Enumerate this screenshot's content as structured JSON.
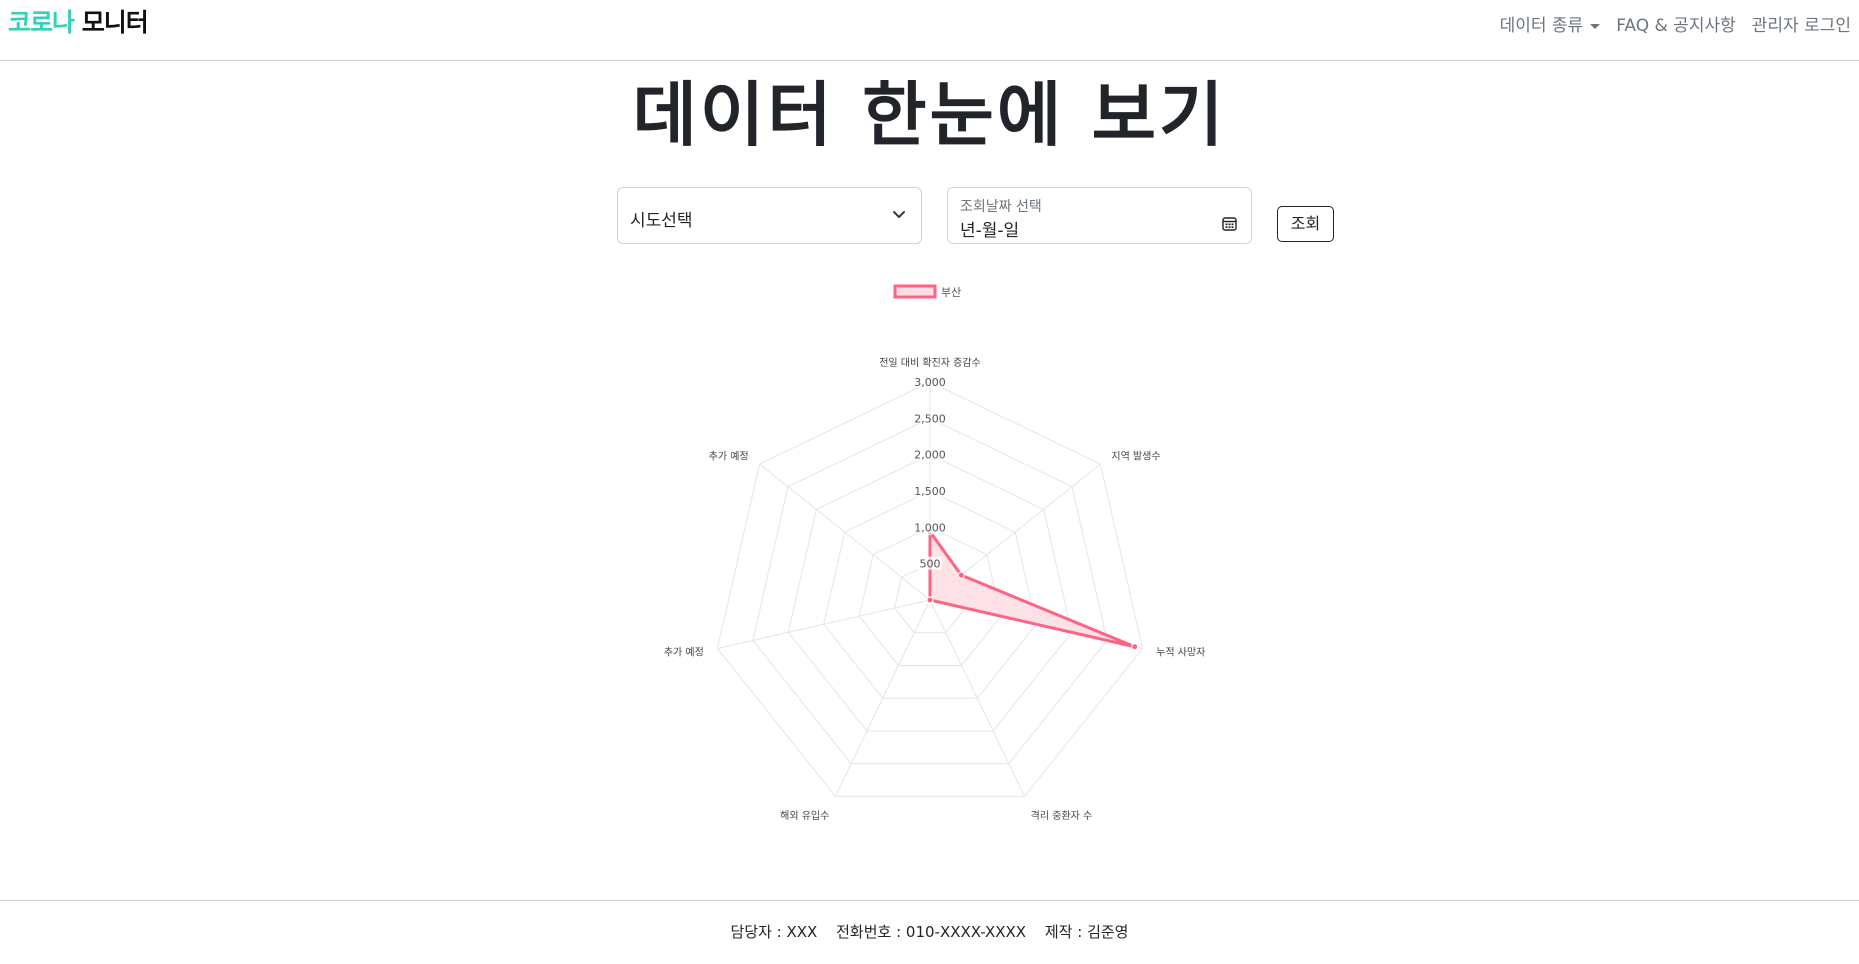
{
  "brand": {
    "part1": "코로나",
    "part2": "모니터"
  },
  "nav": {
    "data_types": "데이터 종류",
    "faq": "FAQ & 공지사항",
    "admin_login": "관리자 로그인"
  },
  "page": {
    "title": "데이터 한눈에 보기"
  },
  "filters": {
    "sido_select": "시도선택",
    "date_label": "조회날짜 선택",
    "date_value": "년-월-일",
    "query_button": "조회"
  },
  "icons": {
    "dropdown_caret": "caret-down-icon",
    "select_chevron": "chevron-down-icon",
    "calendar": "calendar-icon"
  },
  "colors": {
    "brand_accent": "#35d0b9",
    "series_line": "#ff6384",
    "series_fill": "#ffdde4",
    "grid": "#e5e5e5",
    "nav_text": "#6c757d"
  },
  "chart_data": {
    "type": "radar",
    "labels": [
      "전일 대비 확진자 증감수",
      "지역 발생수",
      "누적 사망자",
      "격리 중환자 수",
      "해외 유입수",
      "추가 예정",
      "추가 예정"
    ],
    "series": [
      {
        "name": "부산",
        "values": [
          940,
          550,
          2890,
          0,
          0,
          0,
          0
        ]
      }
    ],
    "rlim": [
      0,
      3000
    ],
    "ticks": [
      "500",
      "1,000",
      "1,500",
      "2,000",
      "2,500",
      "3,000"
    ],
    "legend_position": "top",
    "grid": true
  },
  "footer": {
    "manager": "담당자 : XXX",
    "phone": "전화번호 : 010-XXXX-XXXX",
    "producer": "제작 : 김준영"
  }
}
